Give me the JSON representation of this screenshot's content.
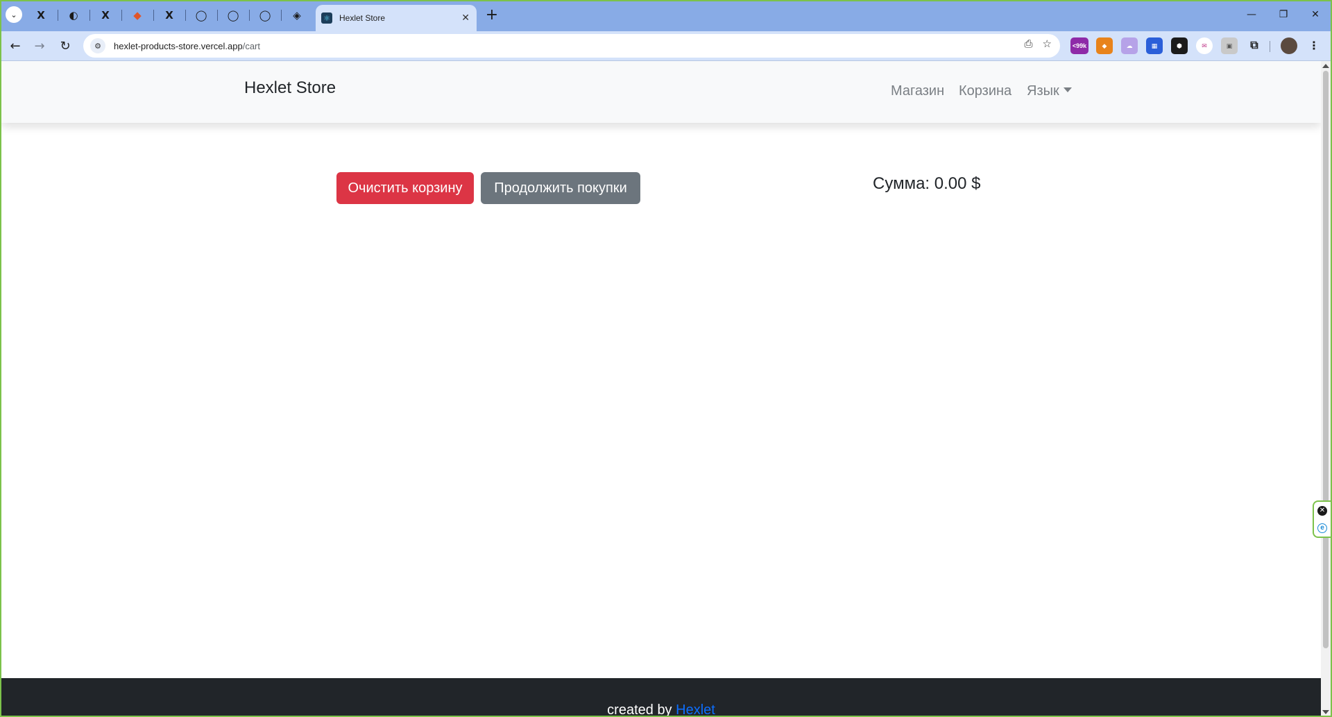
{
  "browser": {
    "pinned_tabs": [
      {
        "icon": "x-icon",
        "glyph": "X"
      },
      {
        "icon": "globe-icon",
        "glyph": "◐"
      },
      {
        "icon": "x-icon",
        "glyph": "X"
      },
      {
        "icon": "git-icon",
        "glyph": "◆"
      },
      {
        "icon": "x-icon",
        "glyph": "X"
      },
      {
        "icon": "github-icon",
        "glyph": "◯"
      },
      {
        "icon": "github-icon",
        "glyph": "◯"
      },
      {
        "icon": "github-icon",
        "glyph": "◯"
      },
      {
        "icon": "compass-icon",
        "glyph": "◈"
      }
    ],
    "active_tab_title": "Hexlet Store",
    "url_host": "hexlet-products-store.vercel.app",
    "url_path": "/cart",
    "colors": {
      "tabstrip": "#88abe6",
      "toolbar": "#d4e2fa",
      "frame": "#7cc24a"
    }
  },
  "navbar": {
    "brand": "Hexlet Store",
    "links": {
      "shop": "Магазин",
      "cart": "Корзина",
      "language": "Язык"
    }
  },
  "cart": {
    "clear_button": "Очистить корзину",
    "continue_button": "Продолжить покупки",
    "sum_text": "Сумма: 0.00 $",
    "colors": {
      "danger": "#dc3545",
      "secondary": "#6c757d"
    }
  },
  "footer": {
    "prefix": "created by",
    "link_text": "Hexlet",
    "colors": {
      "background": "#212529",
      "link": "#0d6efd"
    }
  }
}
